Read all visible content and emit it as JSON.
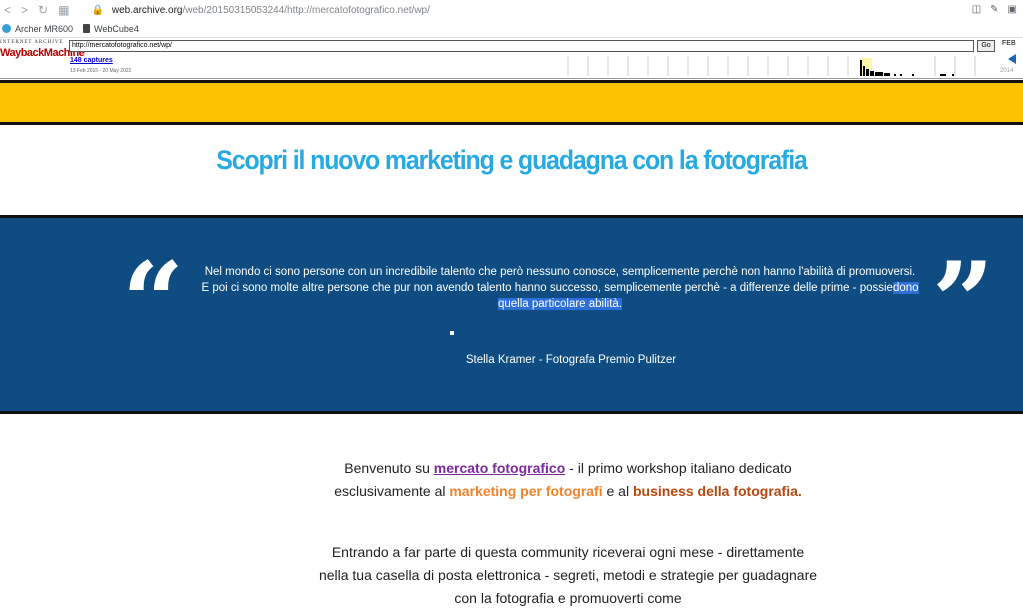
{
  "browser": {
    "url_host": "web.archive.org",
    "url_path": "/web/20150315053244/http://mercatofotografico.net/wp/"
  },
  "bookmarks": [
    {
      "label": "Archer MR600"
    },
    {
      "label": "WebCube4"
    }
  ],
  "wayback": {
    "logo_top": "INTERNET ARCHIVE",
    "logo_main": "WaybackMachine",
    "url_value": "http://mercatofotografico.net/wp/",
    "go_label": "Go",
    "captures": "148 captures",
    "range": "13 Feb 2015 - 20 May 2022",
    "month": "FEB",
    "year": "2014"
  },
  "page": {
    "headline": "Scopri il nuovo marketing e guadagna con la fotografia",
    "quote": {
      "line1": "Nel mondo ci sono persone con un incredibile talento che però nessuno conosce, semplicemente perchè non hanno l'abilità di promuoversi.",
      "line2_pre": "E poi ci sono molte altre persone che pur non avendo talento hanno successo, semplicemente perchè - a differenze delle prime - possie",
      "line2_hl": "dono",
      "line3_hl": "quella particolare abilità.",
      "author": "Stella Kramer - Fotografa Premio Pulitzer"
    },
    "intro": {
      "p1_a": "Benvenuto su ",
      "p1_link": "mercato fotografico",
      "p1_b": " - il primo workshop italiano dedicato esclusivamente al ",
      "p1_orange": "marketing per fotografi",
      "p1_c": " e al ",
      "p1_brown": "business della fotografia.",
      "p2_a": "Entrando a far parte di questa community riceverai ogni mese - direttamente nella tua casella di posta elettronica - segreti, metodi e strategie per ",
      "p2_brown": "guadagnare con la fotografia",
      "p2_b": " e ",
      "p2_orange": "promuoverti come"
    }
  }
}
